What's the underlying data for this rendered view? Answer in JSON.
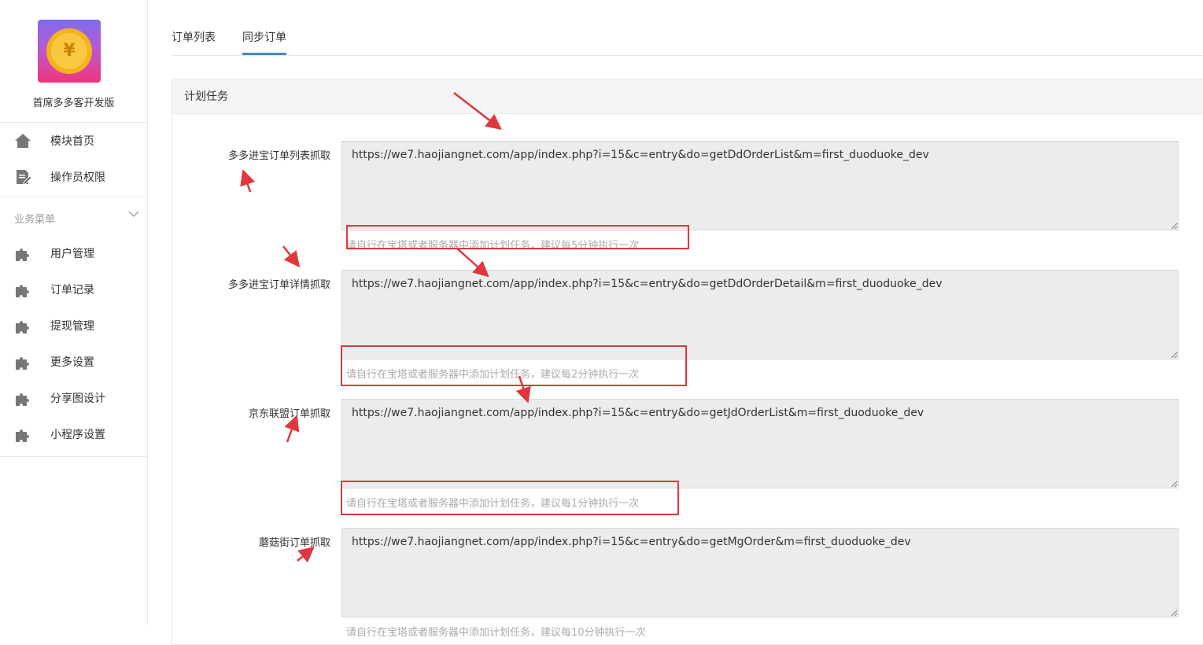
{
  "sidebar": {
    "brand_name": "首席多多客开发版",
    "logo_symbol": "¥",
    "top_items": [
      {
        "label": "模块首页",
        "icon": "home-icon"
      },
      {
        "label": "操作员权限",
        "icon": "document-edit-icon"
      }
    ],
    "group_title": "业务菜单",
    "group_items": [
      {
        "label": "用户管理",
        "icon": "puzzle-icon"
      },
      {
        "label": "订单记录",
        "icon": "puzzle-icon"
      },
      {
        "label": "提现管理",
        "icon": "puzzle-icon"
      },
      {
        "label": "更多设置",
        "icon": "puzzle-icon"
      },
      {
        "label": "分享图设计",
        "icon": "puzzle-icon"
      },
      {
        "label": "小程序设置",
        "icon": "puzzle-icon"
      }
    ]
  },
  "tabs": [
    {
      "label": "订单列表",
      "active": false
    },
    {
      "label": "同步订单",
      "active": true
    }
  ],
  "panel": {
    "title": "计划任务",
    "rows": [
      {
        "label": "多多进宝订单列表抓取",
        "url": "https://we7.haojiangnet.com/app/index.php?i=15&c=entry&do=getDdOrderList&m=first_duoduoke_dev",
        "help": "请自行在宝塔或者服务器中添加计划任务，建议每5分钟执行一次"
      },
      {
        "label": "多多进宝订单详情抓取",
        "url": "https://we7.haojiangnet.com/app/index.php?i=15&c=entry&do=getDdOrderDetail&m=first_duoduoke_dev",
        "help": "请自行在宝塔或者服务器中添加计划任务，建议每2分钟执行一次"
      },
      {
        "label": "京东联盟订单抓取",
        "url": "https://we7.haojiangnet.com/app/index.php?i=15&c=entry&do=getJdOrderList&m=first_duoduoke_dev",
        "help": "请自行在宝塔或者服务器中添加计划任务，建议每1分钟执行一次"
      },
      {
        "label": "蘑菇街订单抓取",
        "url": "https://we7.haojiangnet.com/app/index.php?i=15&c=entry&do=getMgOrder&m=first_duoduoke_dev",
        "help": "请自行在宝塔或者服务器中添加计划任务，建议每10分钟执行一次"
      }
    ]
  },
  "colors": {
    "accent": "#428bca",
    "annotation": "#e0373d",
    "textarea_bg": "#ececec"
  }
}
